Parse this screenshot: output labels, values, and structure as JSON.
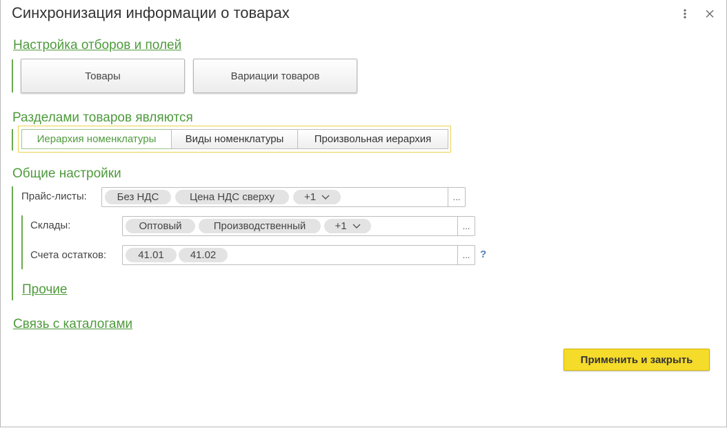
{
  "window": {
    "title": "Синхронизация информации о товарах",
    "more_icon": "kebab-menu-icon",
    "close_icon": "close-icon"
  },
  "filters_section": {
    "link": "Настройка отборов и полей",
    "goods_button": "Товары",
    "variations_button": "Вариации товаров"
  },
  "sections_group": {
    "title": "Разделами товаров являются",
    "options": [
      {
        "label": "Иерархия номенклатуры",
        "selected": true
      },
      {
        "label": "Виды номенклатуры",
        "selected": false
      },
      {
        "label": "Произвольная иерархия",
        "selected": false
      }
    ]
  },
  "general": {
    "title": "Общие настройки",
    "price_lists": {
      "label": "Прайс-листы:",
      "chips": [
        "Без НДС",
        "Цена НДС сверху",
        "+1"
      ],
      "select_button": "..."
    },
    "warehouses": {
      "label": "Склады:",
      "chips": [
        "Оптовый",
        "Производственный",
        "+1"
      ],
      "select_button": "..."
    },
    "accounts": {
      "label": "Счета остатков:",
      "chips": [
        "41.01",
        "41.02"
      ],
      "select_button": "...",
      "help": "?"
    },
    "other_link": "Прочие"
  },
  "catalogs_link": "Связь с каталогами",
  "actions": {
    "apply_close": "Применить и закрыть"
  },
  "colors": {
    "accent_green": "#4e9a3c",
    "primary_yellow": "#f5db2a",
    "help_blue": "#4f7fbf"
  }
}
